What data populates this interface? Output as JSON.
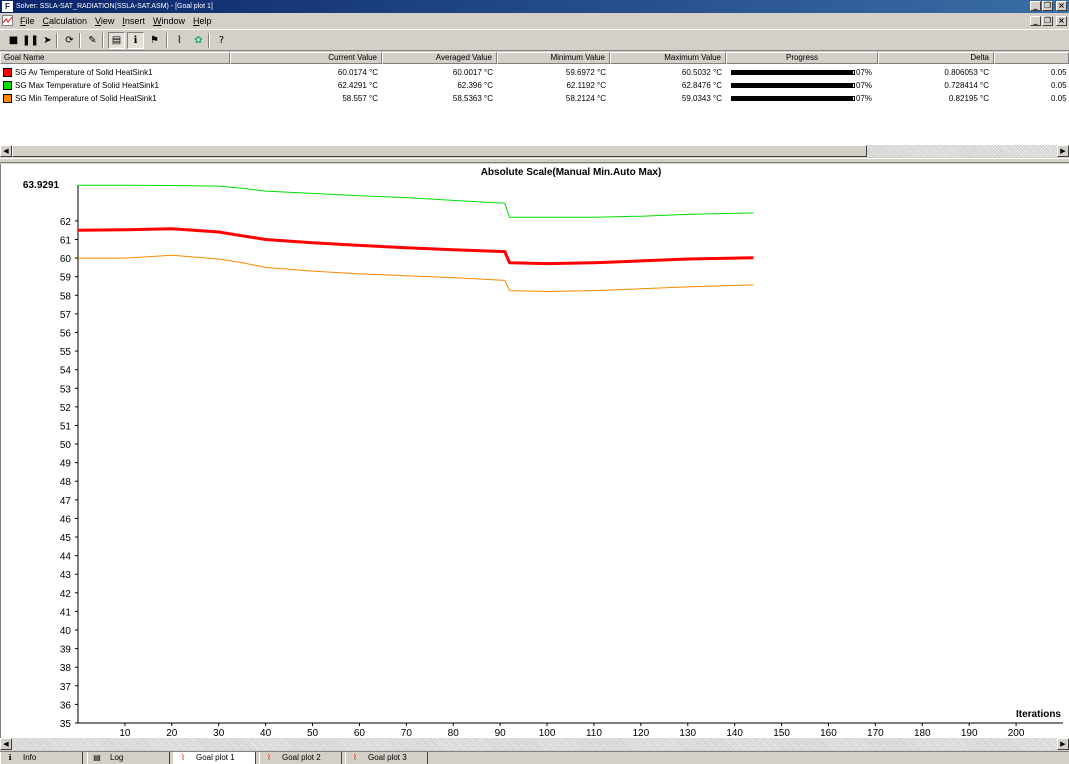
{
  "window": {
    "title": "Solver: SSLA-SAT_RADIATION(SSLA-SAT.ASM) - [Goal plot 1]",
    "app_icon": "solver-app-icon"
  },
  "menu": {
    "items": [
      "File",
      "Calculation",
      "View",
      "Insert",
      "Window",
      "Help"
    ]
  },
  "toolbar": {
    "buttons": [
      {
        "name": "stop-icon",
        "glyph": "■"
      },
      {
        "name": "pause-icon",
        "glyph": "❚❚"
      },
      {
        "name": "step-icon",
        "glyph": "➤"
      },
      {
        "name": "refresh-icon",
        "glyph": "⟳"
      },
      {
        "name": "pin-icon",
        "glyph": "✎"
      },
      {
        "name": "document-icon",
        "glyph": "▤"
      },
      {
        "name": "info-icon",
        "glyph": "ℹ"
      },
      {
        "name": "flag-icon",
        "glyph": "⚑"
      },
      {
        "name": "goal-plot-icon",
        "glyph": "⌇"
      },
      {
        "name": "palette-icon",
        "glyph": "✿"
      },
      {
        "name": "help-icon",
        "glyph": "?"
      }
    ]
  },
  "goals": {
    "columns": [
      "Goal Name",
      "Current Value",
      "Averaged Value",
      "Minimum Value",
      "Maximum Value",
      "Progress",
      "Delta"
    ],
    "rows": [
      {
        "color": "#ff0000",
        "name": "SG Av Temperature of Solid HeatSink1",
        "current": "60.0174 °C",
        "averaged": "60.0017 °C",
        "minimum": "59.6972 °C",
        "maximum": "60.5032 °C",
        "progress": 0.99,
        "progress_text": "07%",
        "delta": "0.806053 °C",
        "extra": "0.05"
      },
      {
        "color": "#00dd00",
        "name": "SG Max Temperature of Solid HeatSink1",
        "current": "62.4291 °C",
        "averaged": "62.396 °C",
        "minimum": "62.1192 °C",
        "maximum": "62.8476 °C",
        "progress": 0.99,
        "progress_text": "07%",
        "delta": "0.728414 °C",
        "extra": "0.05"
      },
      {
        "color": "#ff8800",
        "name": "SG Min Temperature of Solid HeatSink1",
        "current": "58.557 °C",
        "averaged": "58.5363 °C",
        "minimum": "58.2124 °C",
        "maximum": "59.0343 °C",
        "progress": 0.99,
        "progress_text": "07%",
        "delta": "0.82195 °C",
        "extra": "0.05"
      }
    ]
  },
  "chart_data": {
    "type": "line",
    "title": "Absolute Scale(Manual Min.Auto Max)",
    "xlabel": "Iterations",
    "ylabel": "",
    "max_label": "63.9291",
    "xlim": [
      0,
      210
    ],
    "ylim": [
      35,
      63.9291
    ],
    "xticks": [
      10,
      20,
      30,
      40,
      50,
      60,
      70,
      80,
      90,
      100,
      110,
      120,
      130,
      140,
      150,
      160,
      170,
      180,
      190,
      200
    ],
    "yticks": [
      35,
      36,
      37,
      38,
      39,
      40,
      41,
      42,
      43,
      44,
      45,
      46,
      47,
      48,
      49,
      50,
      51,
      52,
      53,
      54,
      55,
      56,
      57,
      58,
      59,
      60,
      61,
      62
    ],
    "grid": false,
    "series": [
      {
        "name": "SG Max Temperature of Solid HeatSink1",
        "color": "#00dd00",
        "width": 1,
        "x": [
          0,
          10,
          20,
          30,
          35,
          40,
          50,
          60,
          70,
          80,
          91,
          92,
          100,
          110,
          120,
          130,
          144
        ],
        "y": [
          63.92,
          63.92,
          63.9,
          63.87,
          63.75,
          63.6,
          63.48,
          63.35,
          63.25,
          63.1,
          62.95,
          62.2,
          62.2,
          62.2,
          62.25,
          62.35,
          62.43
        ]
      },
      {
        "name": "SG Av Temperature of Solid HeatSink1",
        "color": "#ff0000",
        "width": 3,
        "x": [
          0,
          10,
          20,
          30,
          35,
          40,
          50,
          60,
          70,
          80,
          91,
          92,
          100,
          110,
          120,
          130,
          144
        ],
        "y": [
          61.5,
          61.52,
          61.58,
          61.4,
          61.2,
          61.0,
          60.82,
          60.68,
          60.55,
          60.45,
          60.35,
          59.75,
          59.7,
          59.75,
          59.85,
          59.95,
          60.02
        ]
      },
      {
        "name": "SG Min Temperature of Solid HeatSink1",
        "color": "#ff8800",
        "width": 1,
        "x": [
          0,
          10,
          20,
          30,
          35,
          40,
          50,
          60,
          70,
          80,
          91,
          92,
          100,
          110,
          120,
          130,
          144
        ],
        "y": [
          60.0,
          60.0,
          60.15,
          59.95,
          59.75,
          59.5,
          59.3,
          59.15,
          59.05,
          58.95,
          58.8,
          58.25,
          58.2,
          58.25,
          58.35,
          58.45,
          58.56
        ]
      }
    ]
  },
  "tabs": [
    {
      "label": "Info",
      "icon": "info-icon",
      "glyph": "ℹ",
      "active": false
    },
    {
      "label": "Log",
      "icon": "log-icon",
      "glyph": "▤",
      "active": false
    },
    {
      "label": "Goal plot 1",
      "icon": "goal-plot-icon",
      "glyph": "⌇",
      "active": true
    },
    {
      "label": "Goal plot 2",
      "icon": "goal-plot-icon",
      "glyph": "⌇",
      "active": false
    },
    {
      "label": "Goal plot 3",
      "icon": "goal-plot-icon",
      "glyph": "⌇",
      "active": false
    }
  ]
}
